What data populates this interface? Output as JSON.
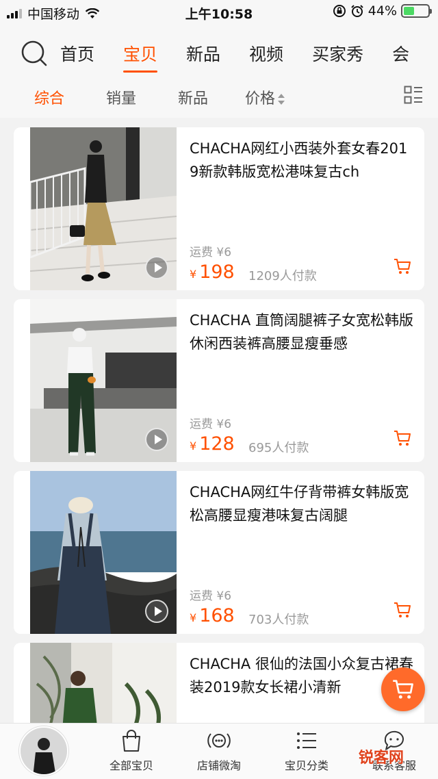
{
  "status_bar": {
    "carrier": "中国移动",
    "time": "上午10:58",
    "battery": "44%",
    "battery_level": 0.44
  },
  "nav": {
    "tabs": [
      "首页",
      "宝贝",
      "新品",
      "视频",
      "买家秀",
      "会"
    ],
    "active": "宝贝"
  },
  "sort": {
    "items": [
      "综合",
      "销量",
      "新品",
      "价格"
    ],
    "active": "综合"
  },
  "products": [
    {
      "title": "CHACHA网红小西装外套女春2019新款韩版宽松港味复古ch",
      "shipping": "运费 ¥6",
      "currency": "¥",
      "price": "198",
      "sold": "1209人付款"
    },
    {
      "title": "CHACHA 直筒阔腿裤子女宽松韩版休闲西装裤高腰显瘦垂感",
      "shipping": "运费 ¥6",
      "currency": "¥",
      "price": "128",
      "sold": "695人付款"
    },
    {
      "title": "CHACHA网红牛仔背带裤女韩版宽松高腰显瘦港味复古阔腿",
      "shipping": "运费 ¥6",
      "currency": "¥",
      "price": "168",
      "sold": "703人付款"
    },
    {
      "title": "CHACHA 很仙的法国小众复古裙春装2019款女长裙小清新",
      "shipping": "",
      "currency": "",
      "price": "",
      "sold": ""
    }
  ],
  "bottom_bar": {
    "items": [
      "全部宝贝",
      "店铺微淘",
      "宝贝分类",
      "联系客服"
    ]
  },
  "watermark": "锐客网",
  "colors": {
    "accent": "#ff5000"
  }
}
